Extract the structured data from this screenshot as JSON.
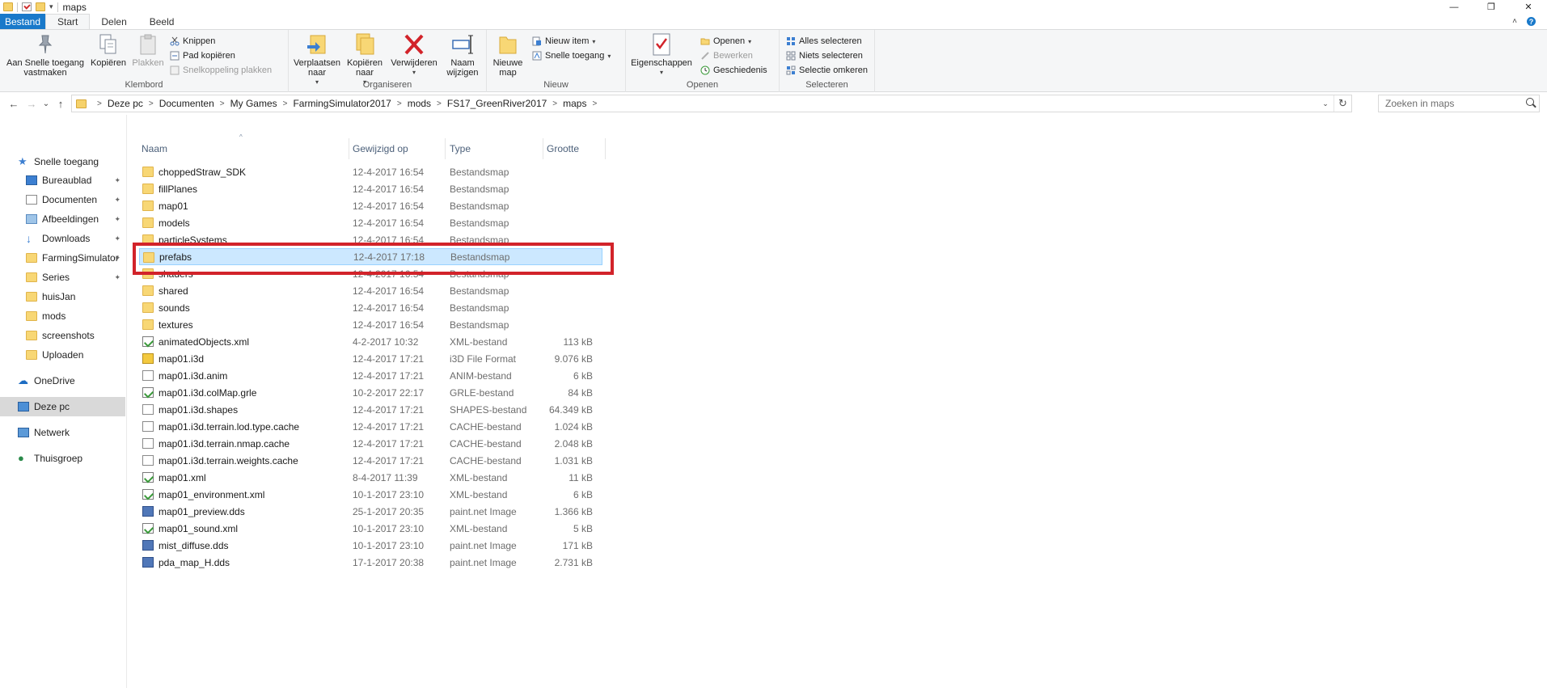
{
  "window": {
    "title": "maps",
    "minimize_glyph": "—",
    "maximize_glyph": "❐",
    "close_glyph": "✕"
  },
  "ribbon_tabs": {
    "file": "Bestand",
    "items": [
      "Start",
      "Delen",
      "Beeld"
    ],
    "collapse_glyph": "˄",
    "help_glyph": "?"
  },
  "ribbon": {
    "klembord": {
      "label": "Klembord",
      "pin": "Aan Snelle toegang\nvastmaken",
      "pin_line1": "Aan Snelle toegang",
      "pin_line2": "vastmaken",
      "copy": "Kopiëren",
      "paste": "Plakken",
      "cut": "Knippen",
      "copy_path": "Pad kopiëren",
      "paste_shortcut": "Snelkoppeling plakken"
    },
    "organiseren": {
      "label": "Organiseren",
      "move_line1": "Verplaatsen",
      "move_line2": "naar",
      "copyto_line1": "Kopiëren",
      "copyto_line2": "naar",
      "delete": "Verwijderen",
      "rename_line1": "Naam",
      "rename_line2": "wijzigen"
    },
    "nieuw": {
      "label": "Nieuw",
      "newfolder_line1": "Nieuwe",
      "newfolder_line2": "map",
      "new_item": "Nieuw item",
      "easy_access": "Snelle toegang"
    },
    "openen": {
      "label": "Openen",
      "properties": "Eigenschappen",
      "open": "Openen",
      "edit": "Bewerken",
      "history": "Geschiedenis"
    },
    "selecteren": {
      "label": "Selecteren",
      "select_all": "Alles selecteren",
      "select_none": "Niets selecteren",
      "invert": "Selectie omkeren"
    }
  },
  "navigation": {
    "back_glyph": "←",
    "forward_glyph": "→",
    "recent_glyph": "⌄",
    "up_glyph": "↑",
    "breadcrumb": [
      "Deze pc",
      "Documenten",
      "My Games",
      "FarmingSimulator2017",
      "mods",
      "FS17_GreenRiver2017",
      "maps"
    ],
    "crumb_sep": ">",
    "refresh_glyph": "↻",
    "dropdown_glyph": "⌄",
    "search_placeholder": "Zoeken in maps"
  },
  "nav_pane": {
    "quick_access": "Snelle toegang",
    "pinned": [
      "Bureaublad",
      "Documenten",
      "Afbeeldingen",
      "Downloads",
      "FarmingSimulator",
      "Series"
    ],
    "recent": [
      "huisJan",
      "mods",
      "screenshots",
      "Uploaden"
    ],
    "onedrive": "OneDrive",
    "this_pc": "Deze pc",
    "network": "Netwerk",
    "homegroup": "Thuisgroep",
    "pin_glyph": "📌"
  },
  "columns": {
    "name": "Naam",
    "date": "Gewijzigd op",
    "type": "Type",
    "size": "Grootte"
  },
  "files": [
    {
      "name": "choppedStraw_SDK",
      "date": "12-4-2017 16:54",
      "type": "Bestandsmap",
      "size": "",
      "icon": "folder-icon"
    },
    {
      "name": "fillPlanes",
      "date": "12-4-2017 16:54",
      "type": "Bestandsmap",
      "size": "",
      "icon": "folder-icon"
    },
    {
      "name": "map01",
      "date": "12-4-2017 16:54",
      "type": "Bestandsmap",
      "size": "",
      "icon": "folder-icon"
    },
    {
      "name": "models",
      "date": "12-4-2017 16:54",
      "type": "Bestandsmap",
      "size": "",
      "icon": "folder-icon"
    },
    {
      "name": "particleSystems",
      "date": "12-4-2017 16:54",
      "type": "Bestandsmap",
      "size": "",
      "icon": "folder-icon"
    },
    {
      "name": "prefabs",
      "date": "12-4-2017 17:18",
      "type": "Bestandsmap",
      "size": "",
      "icon": "folder-icon",
      "selected": true
    },
    {
      "name": "shaders",
      "date": "12-4-2017 16:54",
      "type": "Bestandsmap",
      "size": "",
      "icon": "folder-icon"
    },
    {
      "name": "shared",
      "date": "12-4-2017 16:54",
      "type": "Bestandsmap",
      "size": "",
      "icon": "folder-icon"
    },
    {
      "name": "sounds",
      "date": "12-4-2017 16:54",
      "type": "Bestandsmap",
      "size": "",
      "icon": "folder-icon"
    },
    {
      "name": "textures",
      "date": "12-4-2017 16:54",
      "type": "Bestandsmap",
      "size": "",
      "icon": "folder-icon"
    },
    {
      "name": "animatedObjects.xml",
      "date": "4-2-2017 10:32",
      "type": "XML-bestand",
      "size": "113 kB",
      "icon": "xml-icon"
    },
    {
      "name": "map01.i3d",
      "date": "12-4-2017 17:21",
      "type": "i3D File Format",
      "size": "9.076 kB",
      "icon": "i3d-icon"
    },
    {
      "name": "map01.i3d.anim",
      "date": "12-4-2017 17:21",
      "type": "ANIM-bestand",
      "size": "6 kB",
      "icon": "document-icon"
    },
    {
      "name": "map01.i3d.colMap.grle",
      "date": "10-2-2017 22:17",
      "type": "GRLE-bestand",
      "size": "84 kB",
      "icon": "xml-icon"
    },
    {
      "name": "map01.i3d.shapes",
      "date": "12-4-2017 17:21",
      "type": "SHAPES-bestand",
      "size": "64.349 kB",
      "icon": "document-icon"
    },
    {
      "name": "map01.i3d.terrain.lod.type.cache",
      "date": "12-4-2017 17:21",
      "type": "CACHE-bestand",
      "size": "1.024 kB",
      "icon": "document-icon"
    },
    {
      "name": "map01.i3d.terrain.nmap.cache",
      "date": "12-4-2017 17:21",
      "type": "CACHE-bestand",
      "size": "2.048 kB",
      "icon": "document-icon"
    },
    {
      "name": "map01.i3d.terrain.weights.cache",
      "date": "12-4-2017 17:21",
      "type": "CACHE-bestand",
      "size": "1.031 kB",
      "icon": "document-icon"
    },
    {
      "name": "map01.xml",
      "date": "8-4-2017 11:39",
      "type": "XML-bestand",
      "size": "11 kB",
      "icon": "xml-icon"
    },
    {
      "name": "map01_environment.xml",
      "date": "10-1-2017 23:10",
      "type": "XML-bestand",
      "size": "6 kB",
      "icon": "xml-icon"
    },
    {
      "name": "map01_preview.dds",
      "date": "25-1-2017 20:35",
      "type": "paint.net Image",
      "size": "1.366 kB",
      "icon": "image-icon"
    },
    {
      "name": "map01_sound.xml",
      "date": "10-1-2017 23:10",
      "type": "XML-bestand",
      "size": "5 kB",
      "icon": "xml-icon"
    },
    {
      "name": "mist_diffuse.dds",
      "date": "10-1-2017 23:10",
      "type": "paint.net Image",
      "size": "171 kB",
      "icon": "image-icon"
    },
    {
      "name": "pda_map_H.dds",
      "date": "17-1-2017 20:38",
      "type": "paint.net Image",
      "size": "2.731 kB",
      "icon": "image-icon"
    }
  ],
  "colors": {
    "file_tab": "#1979ca",
    "selection_bg": "#cce8ff",
    "highlight_box": "#d2232a",
    "folder": "#f8d775"
  }
}
